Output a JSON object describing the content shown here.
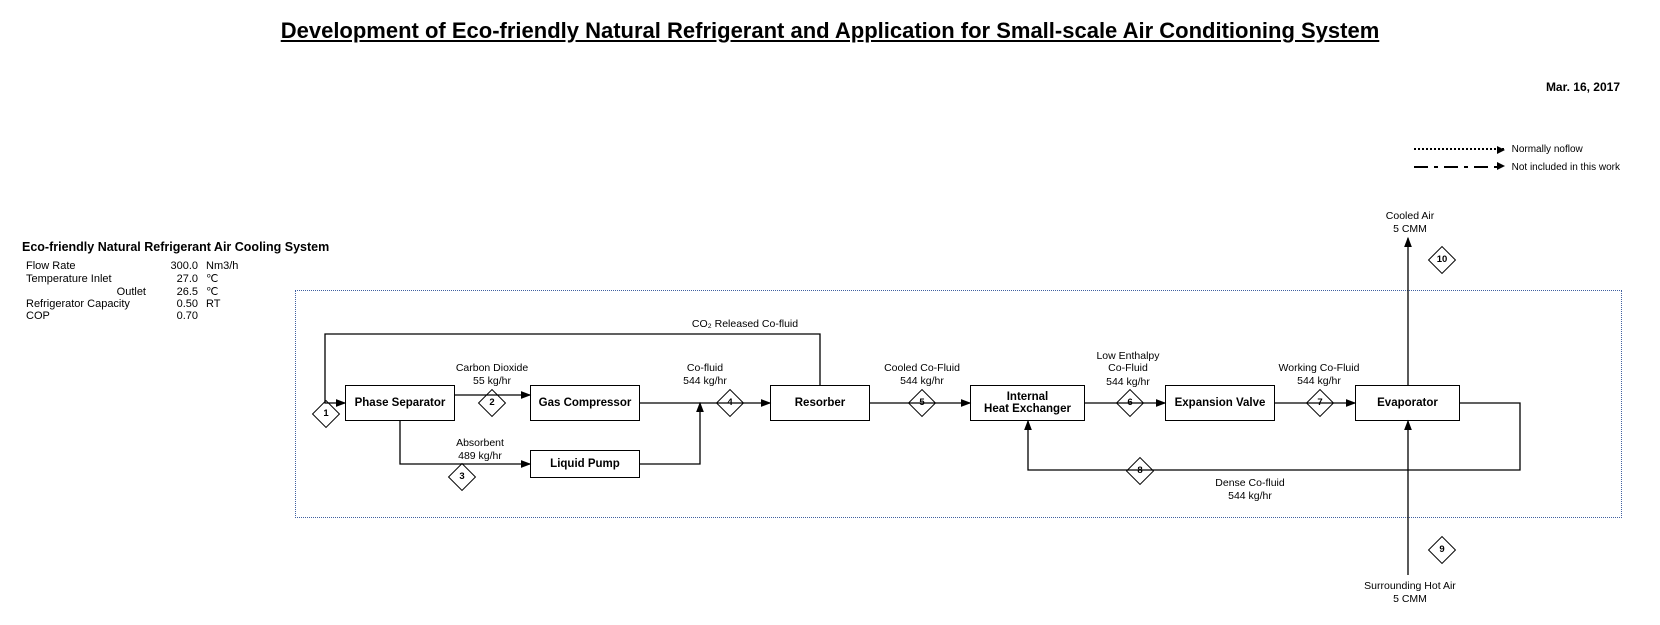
{
  "title": "Development of Eco-friendly Natural Refrigerant and Application for Small-scale Air Conditioning System",
  "date": "Mar. 16, 2017",
  "legend": {
    "normally_noflow": "Normally noflow",
    "not_included": "Not included in this work"
  },
  "params": {
    "header": "Eco-friendly Natural Refrigerant Air Cooling System",
    "rows": [
      {
        "label": "Flow Rate",
        "value": "300.0",
        "unit": "Nm3/h"
      },
      {
        "label": "Temperature Inlet",
        "value": "27.0",
        "unit": "℃"
      },
      {
        "label": "Outlet",
        "value": "26.5",
        "unit": "℃",
        "indent": true
      },
      {
        "label": "Refrigerator Capacity",
        "value": "0.50",
        "unit": "RT"
      },
      {
        "label": "COP",
        "value": "0.70",
        "unit": ""
      }
    ]
  },
  "components": {
    "phase_separator": "Phase Separator",
    "gas_compressor": "Gas Compressor",
    "liquid_pump": "Liquid Pump",
    "resorber": "Resorber",
    "internal_hx": "Internal\nHeat Exchanger",
    "expansion_valve": "Expansion Valve",
    "evaporator": "Evaporator"
  },
  "streams": {
    "s1": {
      "num": "1",
      "label_top": "CO₂ Released Co-fluid",
      "rate": ""
    },
    "s2": {
      "num": "2",
      "label_top": "Carbon Dioxide",
      "rate": "55  kg/hr"
    },
    "s3": {
      "num": "3",
      "label_top": "Absorbent",
      "rate": "489  kg/hr"
    },
    "s4": {
      "num": "4",
      "label_top": "Co-fluid",
      "rate": "544  kg/hr"
    },
    "s5": {
      "num": "5",
      "label_top": "Cooled Co-Fluid",
      "rate": "544  kg/hr"
    },
    "s6": {
      "num": "6",
      "label_top": "Low Enthalpy\nCo-Fluid",
      "rate": "544 kg/hr"
    },
    "s7": {
      "num": "7",
      "label_top": "Working Co-Fluid",
      "rate": "544 kg/hr"
    },
    "s8": {
      "num": "8",
      "label_top": "Dense Co-fluid",
      "rate": "544 kg/hr"
    },
    "s9": {
      "num": "9",
      "label_top": "Surrounding Hot Air",
      "rate": "5 CMM"
    },
    "s10": {
      "num": "10",
      "label_top": "Cooled Air",
      "rate": "5 CMM"
    }
  }
}
